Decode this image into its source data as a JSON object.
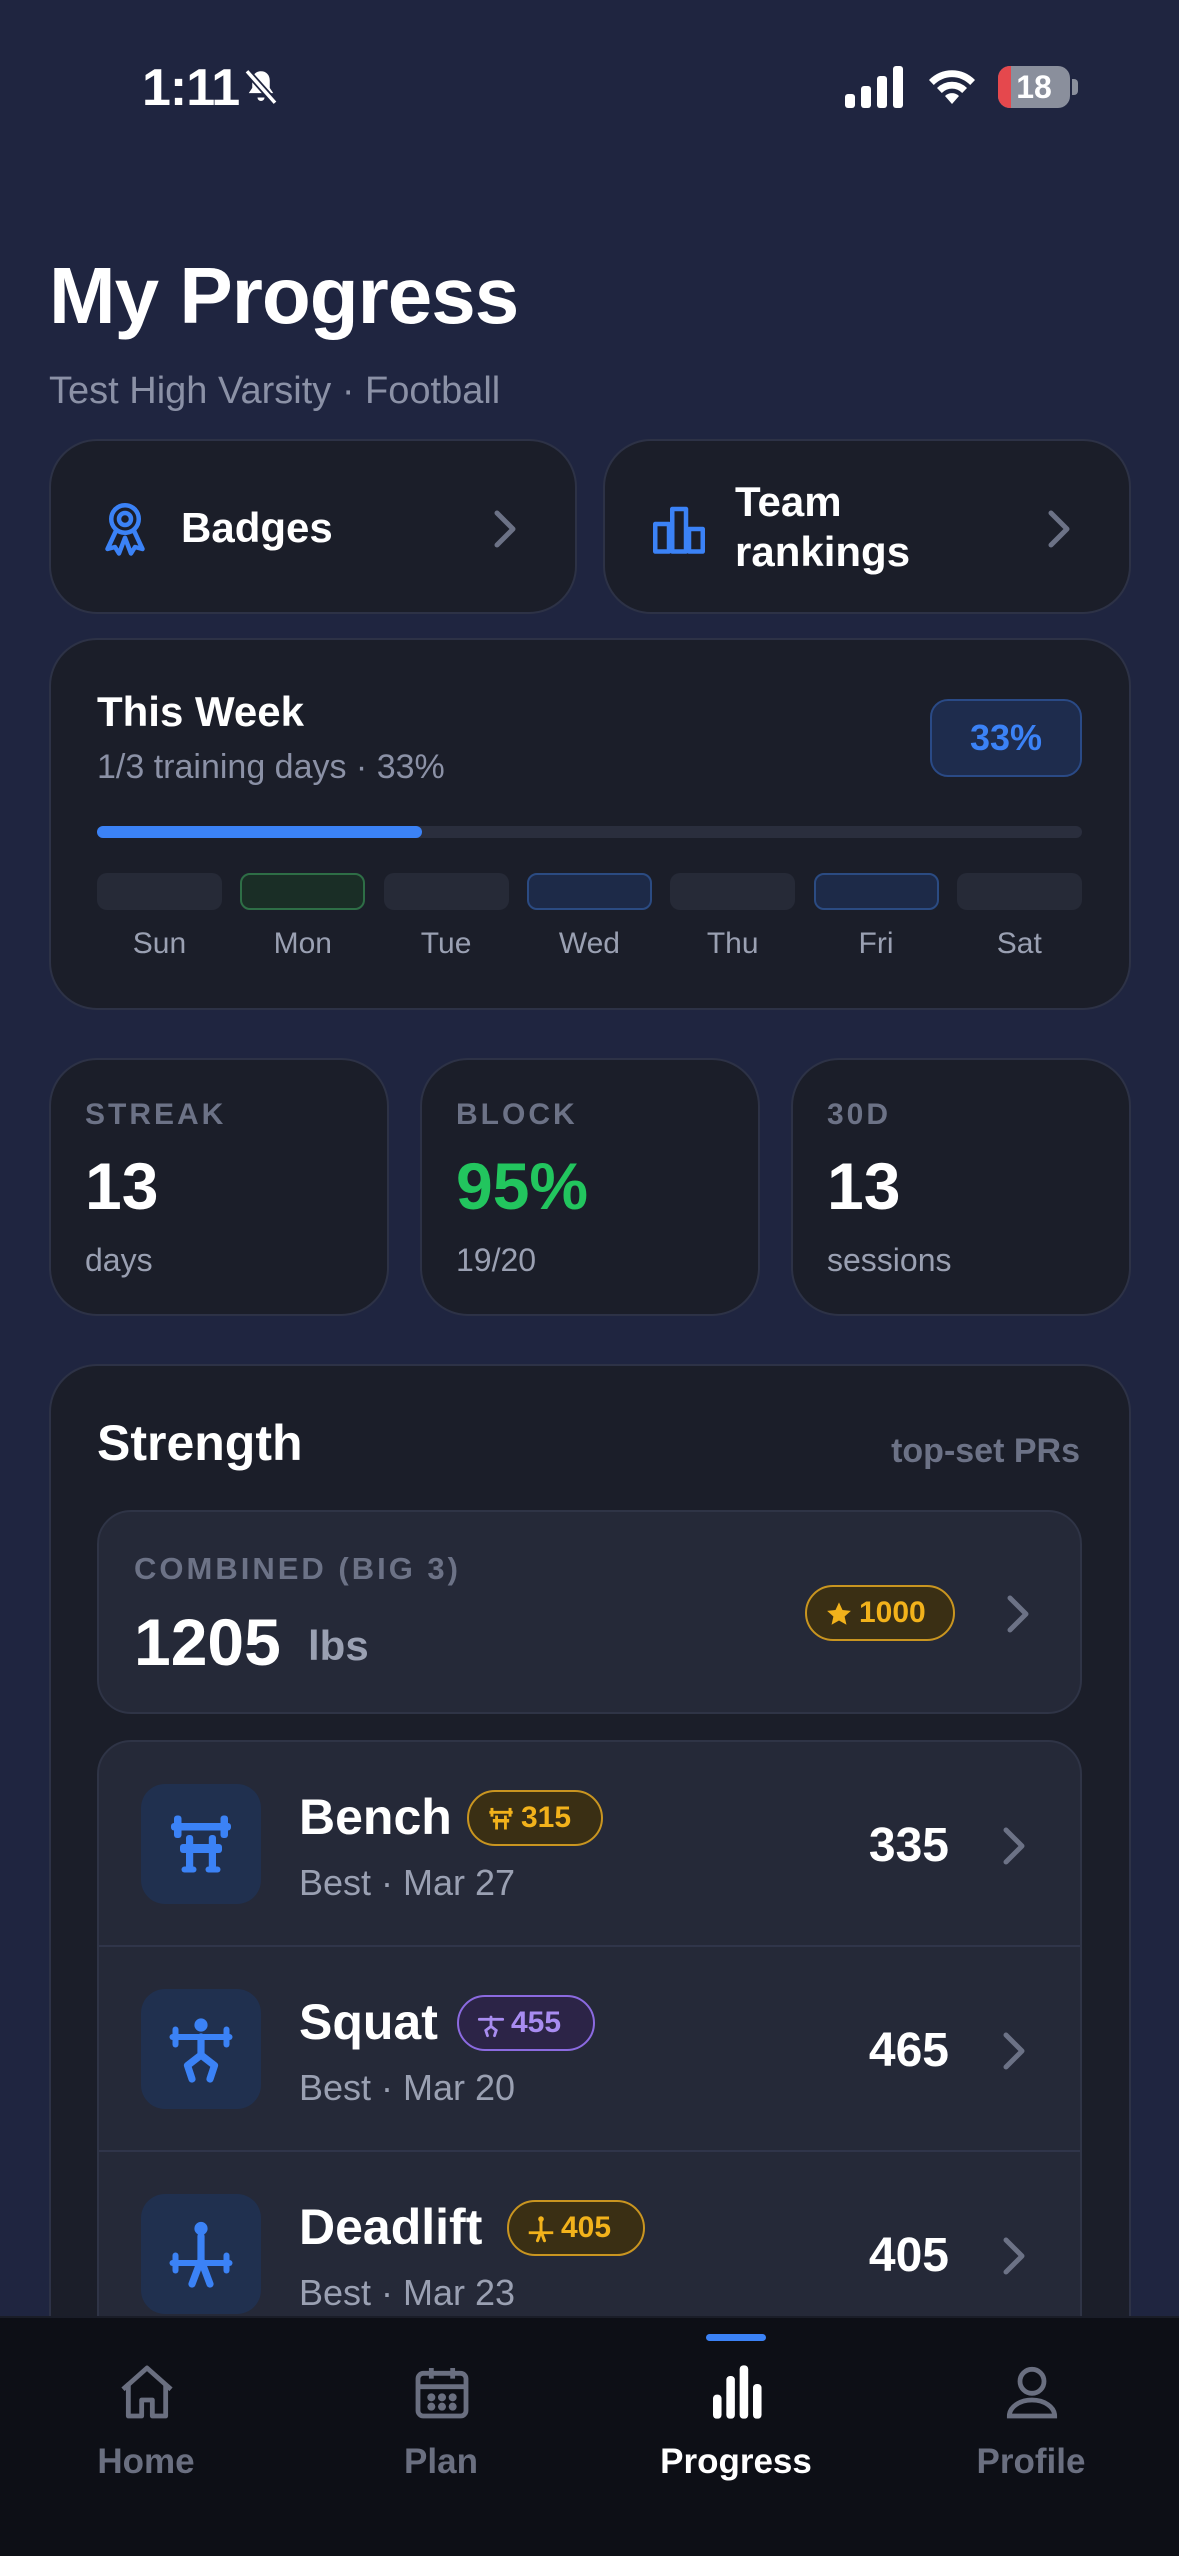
{
  "status_bar": {
    "time": "1:11",
    "battery": "18",
    "battery_level": 0.18
  },
  "header": {
    "title": "My Progress",
    "subtitle": "Test High Varsity · Football"
  },
  "quick_links": [
    {
      "label": "Badges",
      "icon": "award-ribbon-icon"
    },
    {
      "label": "Team rankings",
      "icon": "bar-chart-icon"
    }
  ],
  "week": {
    "title": "This Week",
    "subtitle": "1/3 training days · 33%",
    "badge": "33%",
    "progress": 0.33,
    "days": [
      {
        "label": "Sun",
        "state": "none"
      },
      {
        "label": "Mon",
        "state": "done"
      },
      {
        "label": "Tue",
        "state": "none"
      },
      {
        "label": "Wed",
        "state": "planned"
      },
      {
        "label": "Thu",
        "state": "none"
      },
      {
        "label": "Fri",
        "state": "planned"
      },
      {
        "label": "Sat",
        "state": "none"
      }
    ]
  },
  "stats": [
    {
      "label": "STREAK",
      "value": "13",
      "sub": "days",
      "color": "#ffffff"
    },
    {
      "label": "BLOCK",
      "value": "95%",
      "sub": "19/20",
      "color": "#22c55e"
    },
    {
      "label": "30D",
      "value": "13",
      "sub": "sessions",
      "color": "#ffffff"
    }
  ],
  "strength": {
    "title": "Strength",
    "note": "top-set PRs",
    "combined": {
      "label": "COMBINED (BIG 3)",
      "value": "1205",
      "unit": "lbs",
      "badge": "1000",
      "badge_icon": "star-icon"
    },
    "lifts": [
      {
        "name": "Bench",
        "date": "Best · Mar 27",
        "value": "335",
        "badge": "315",
        "badge_color": "gold",
        "icon": "bench-press-icon"
      },
      {
        "name": "Squat",
        "date": "Best · Mar 20",
        "value": "465",
        "badge": "455",
        "badge_color": "purple",
        "icon": "squat-icon"
      },
      {
        "name": "Deadlift",
        "date": "Best · Mar 23",
        "value": "405",
        "badge": "405",
        "badge_color": "gold",
        "icon": "deadlift-icon"
      }
    ]
  },
  "tabs": [
    {
      "label": "Home",
      "icon": "home-icon",
      "active": false
    },
    {
      "label": "Plan",
      "icon": "calendar-icon",
      "active": false
    },
    {
      "label": "Progress",
      "icon": "bar-chart-icon",
      "active": true
    },
    {
      "label": "Profile",
      "icon": "person-icon",
      "active": false
    }
  ],
  "colors": {
    "accent": "#3b82f6",
    "success": "#22c55e",
    "gold": "#f2b21b",
    "purple": "#a88cf0",
    "background": "#1f2540"
  }
}
